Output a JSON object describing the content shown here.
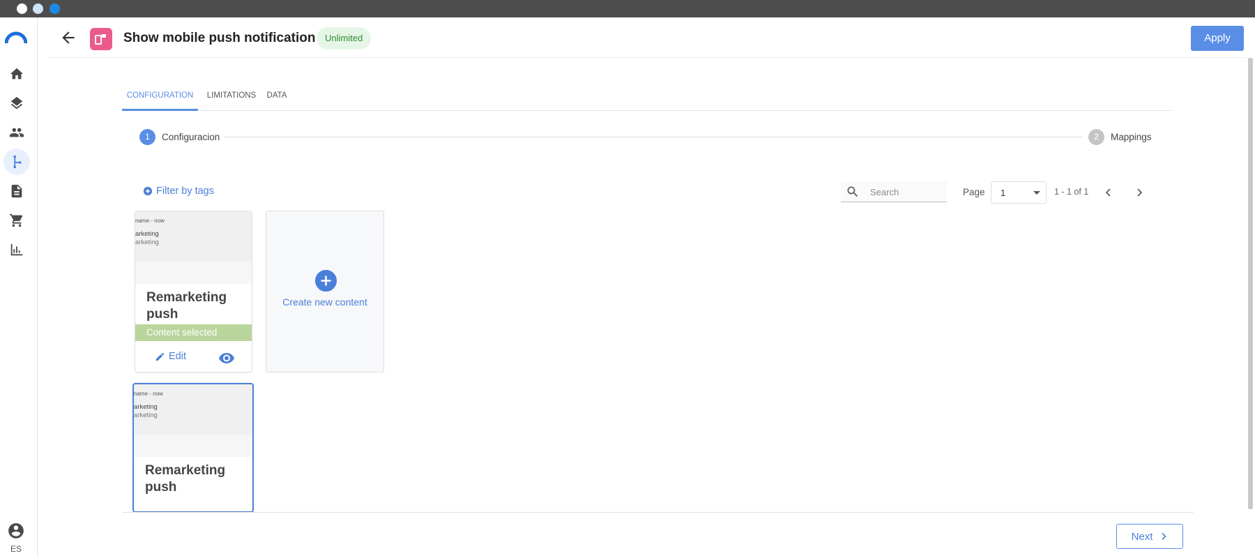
{
  "window": {
    "controls": [
      "close",
      "minimize",
      "zoom"
    ]
  },
  "rail": {
    "items": [
      {
        "icon": "home-icon"
      },
      {
        "icon": "layers-icon"
      },
      {
        "icon": "people-icon"
      },
      {
        "icon": "flow-icon",
        "active": true
      },
      {
        "icon": "document-icon"
      },
      {
        "icon": "cart-icon"
      },
      {
        "icon": "bar-chart-icon"
      }
    ],
    "language": "ES"
  },
  "header": {
    "title": "Show mobile push notification",
    "badge": "Unlimited",
    "apply_label": "Apply"
  },
  "tabs": [
    {
      "label": "CONFIGURATION",
      "active": true
    },
    {
      "label": "LIMITATIONS",
      "active": false
    },
    {
      "label": "DATA",
      "active": false
    }
  ],
  "stepper": {
    "steps": [
      {
        "number": "1",
        "label": "Configuracion",
        "active": true
      },
      {
        "number": "2",
        "label": "Mappings",
        "active": false
      }
    ]
  },
  "toolbar": {
    "filter_label": "Filter by tags",
    "search_placeholder": "Search",
    "page_label": "Page",
    "page_value": "1",
    "range_text": "1 - 1 of 1"
  },
  "cards": [
    {
      "preview_line1": "name - now",
      "preview_line2": "arketing",
      "preview_line3": "arketing",
      "name": "Remarketing push",
      "status": "Content selected",
      "edit_label": "Edit"
    },
    {
      "preview_line1": "name - now",
      "preview_line2": "arketing",
      "preview_line3": "arketing",
      "name": "Remarketing push"
    }
  ],
  "create_card": {
    "label": "Create new content"
  },
  "footer": {
    "next_label": "Next"
  },
  "colors": {
    "accent": "#5a8ee6",
    "link": "#4a7fd9",
    "brand_icon": "#ec5a8c",
    "badge_bg": "#e6f6e6",
    "badge_text": "#2e8b2e",
    "selected_bar": "#b9d59c"
  }
}
